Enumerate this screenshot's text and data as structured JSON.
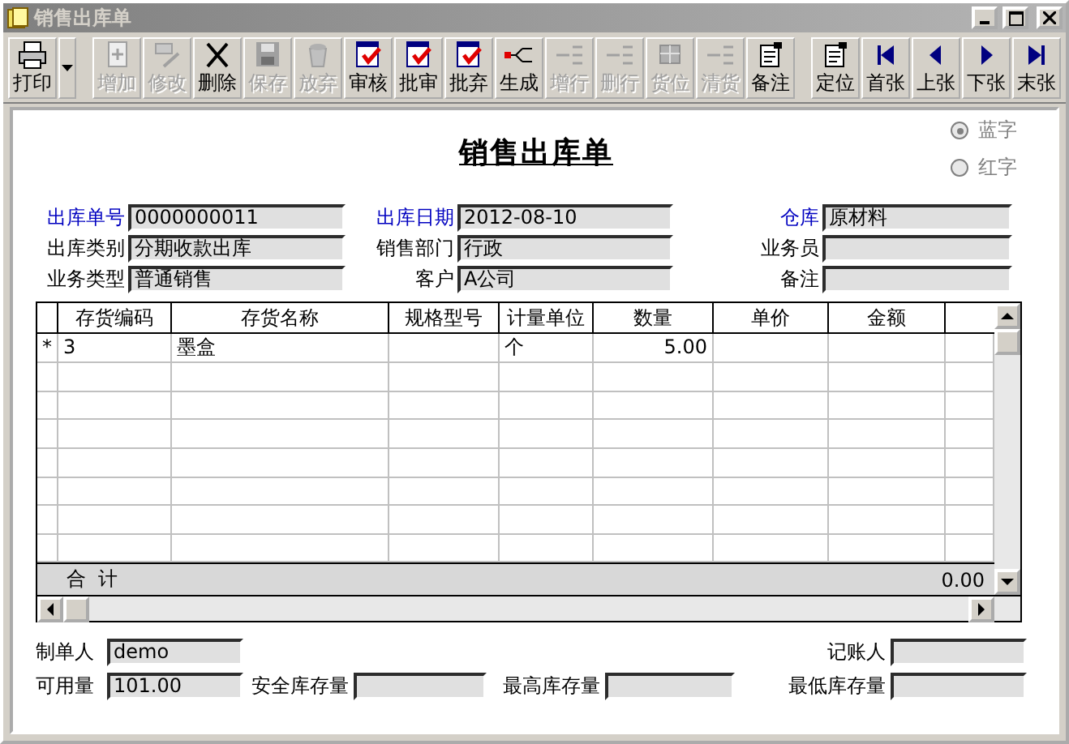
{
  "window": {
    "title": "销售出库单"
  },
  "toolbar": [
    {
      "buttons": [
        {
          "label": "打印",
          "kind": "printer",
          "disabled": false,
          "dropdown": true
        }
      ]
    },
    {
      "buttons": [
        {
          "label": "增加",
          "kind": "add",
          "disabled": true
        },
        {
          "label": "修改",
          "kind": "edit",
          "disabled": true
        },
        {
          "label": "删除",
          "kind": "delete",
          "disabled": false
        },
        {
          "label": "保存",
          "kind": "save",
          "disabled": true
        },
        {
          "label": "放弃",
          "kind": "discard",
          "disabled": true
        },
        {
          "label": "审核",
          "kind": "audit",
          "disabled": false
        },
        {
          "label": "批审",
          "kind": "audit",
          "disabled": false
        },
        {
          "label": "批弃",
          "kind": "audit",
          "disabled": false
        },
        {
          "label": "生成",
          "kind": "generate",
          "disabled": false
        },
        {
          "label": "增行",
          "kind": "addrow",
          "disabled": true
        },
        {
          "label": "删行",
          "kind": "delrow",
          "disabled": true
        },
        {
          "label": "货位",
          "kind": "location",
          "disabled": true
        },
        {
          "label": "清货",
          "kind": "clear",
          "disabled": true
        },
        {
          "label": "备注",
          "kind": "note",
          "disabled": false
        }
      ]
    },
    {
      "buttons": [
        {
          "label": "定位",
          "kind": "note",
          "disabled": false
        },
        {
          "label": "首张",
          "kind": "first",
          "disabled": false
        },
        {
          "label": "上张",
          "kind": "prev",
          "disabled": false
        },
        {
          "label": "下张",
          "kind": "next",
          "disabled": false
        },
        {
          "label": "末张",
          "kind": "last",
          "disabled": false
        }
      ]
    }
  ],
  "form_title": "销售出库单",
  "color_options": [
    {
      "label": "蓝字",
      "selected": true
    },
    {
      "label": "红字",
      "selected": false
    }
  ],
  "header_fields": [
    {
      "label": "出库单号",
      "value": "0000000011",
      "required": true
    },
    {
      "label": "出库日期",
      "value": "2012-08-10",
      "required": true
    },
    {
      "label": "仓库",
      "value": "原材料",
      "required": true
    },
    {
      "label": "出库类别",
      "value": "分期收款出库",
      "required": false
    },
    {
      "label": "销售部门",
      "value": "行政",
      "required": false
    },
    {
      "label": "业务员",
      "required": false
    },
    {
      "label": "业务类型",
      "value": "普通销售",
      "required": false
    },
    {
      "label": "客户",
      "value": "A公司",
      "required": false
    },
    {
      "label": "备注",
      "required": false
    }
  ],
  "table": {
    "columns": [
      "存货编码",
      "存货名称",
      "规格型号",
      "计量单位",
      "数量",
      "单价",
      "金额"
    ],
    "rows": [
      {
        "marker": "*",
        "cells": [
          "3",
          "墨盒",
          null,
          "个",
          "5.00",
          null,
          null
        ]
      }
    ],
    "total": {
      "label": "合  计",
      "amount": "0.00"
    }
  },
  "footer_fields": [
    {
      "label": "制单人",
      "value": "demo"
    },
    {
      "label": "记账人"
    },
    {
      "label": "可用量",
      "value": "101.00"
    },
    {
      "label": "安全库存量"
    },
    {
      "label": "最高库存量"
    },
    {
      "label": "最低库存量"
    }
  ]
}
